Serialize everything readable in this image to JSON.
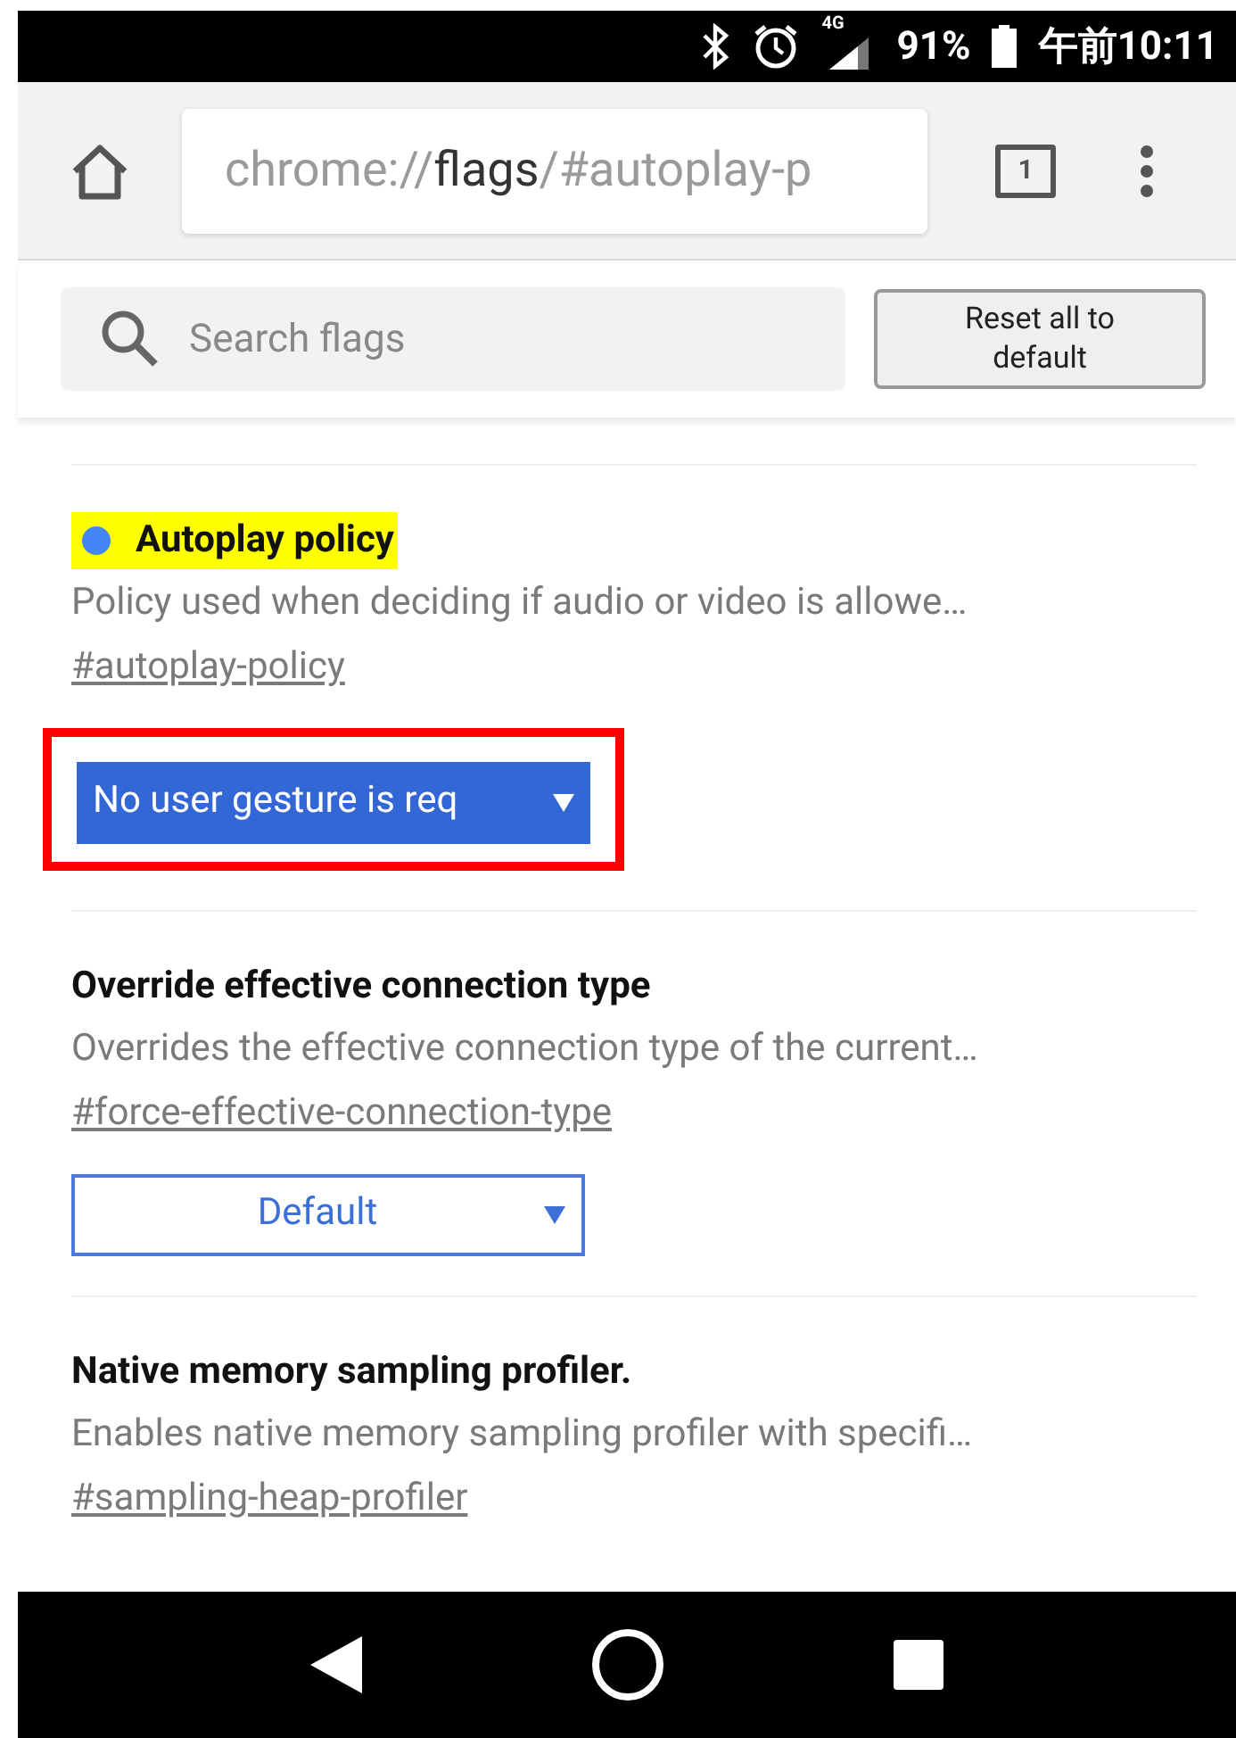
{
  "status_bar": {
    "network": "4G",
    "battery": "91%",
    "time": "午前10:11"
  },
  "toolbar": {
    "url_scheme": "chrome://",
    "url_host": "flags",
    "url_path": "/#autoplay-p",
    "tab_count": "1"
  },
  "search": {
    "placeholder": "Search flags"
  },
  "reset_button": "Reset all to default",
  "flags": [
    {
      "title": "Autoplay policy",
      "highlighted": true,
      "modified": true,
      "description": "Policy used when deciding if audio or video is allowe…",
      "link": "#autoplay-policy",
      "select": "No user gesture is req"
    },
    {
      "title": "Override effective connection type",
      "highlighted": false,
      "modified": false,
      "description": "Overrides the effective connection type of the current…",
      "link": "#force-effective-connection-type",
      "select": "Default"
    },
    {
      "title": "Native memory sampling profiler.",
      "highlighted": false,
      "modified": false,
      "description": "Enables native memory sampling profiler with specifi…",
      "link": "#sampling-heap-profiler"
    }
  ]
}
